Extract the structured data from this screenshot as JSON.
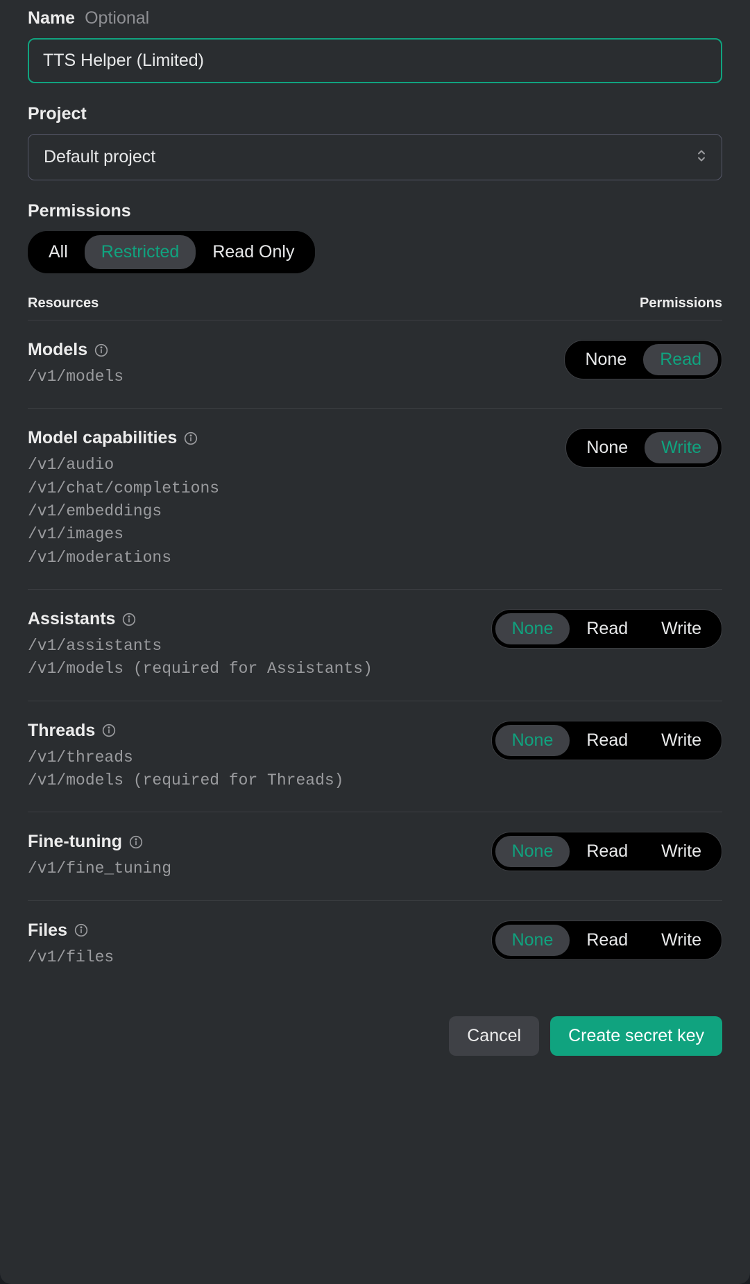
{
  "name": {
    "label": "Name",
    "optional": "Optional",
    "value": "TTS Helper (Limited)"
  },
  "project": {
    "label": "Project",
    "selected": "Default project"
  },
  "permissions": {
    "label": "Permissions",
    "tabs": {
      "all": "All",
      "restricted": "Restricted",
      "read_only": "Read Only"
    },
    "active_tab": "restricted"
  },
  "table_headers": {
    "resources": "Resources",
    "permissions": "Permissions"
  },
  "perm_labels": {
    "none": "None",
    "read": "Read",
    "write": "Write"
  },
  "resources": {
    "models": {
      "title": "Models",
      "endpoints": [
        "/v1/models"
      ],
      "options": [
        "none",
        "read"
      ],
      "selected": "read"
    },
    "model_capabilities": {
      "title": "Model capabilities",
      "endpoints": [
        "/v1/audio",
        "/v1/chat/completions",
        "/v1/embeddings",
        "/v1/images",
        "/v1/moderations"
      ],
      "options": [
        "none",
        "write"
      ],
      "selected": "write"
    },
    "assistants": {
      "title": "Assistants",
      "endpoints": [
        "/v1/assistants",
        "/v1/models (required for Assistants)"
      ],
      "options": [
        "none",
        "read",
        "write"
      ],
      "selected": "none"
    },
    "threads": {
      "title": "Threads",
      "endpoints": [
        "/v1/threads",
        "/v1/models (required for Threads)"
      ],
      "options": [
        "none",
        "read",
        "write"
      ],
      "selected": "none"
    },
    "fine_tuning": {
      "title": "Fine-tuning",
      "endpoints": [
        "/v1/fine_tuning"
      ],
      "options": [
        "none",
        "read",
        "write"
      ],
      "selected": "none"
    },
    "files": {
      "title": "Files",
      "endpoints": [
        "/v1/files"
      ],
      "options": [
        "none",
        "read",
        "write"
      ],
      "selected": "none"
    }
  },
  "footer": {
    "cancel": "Cancel",
    "create": "Create secret key"
  }
}
